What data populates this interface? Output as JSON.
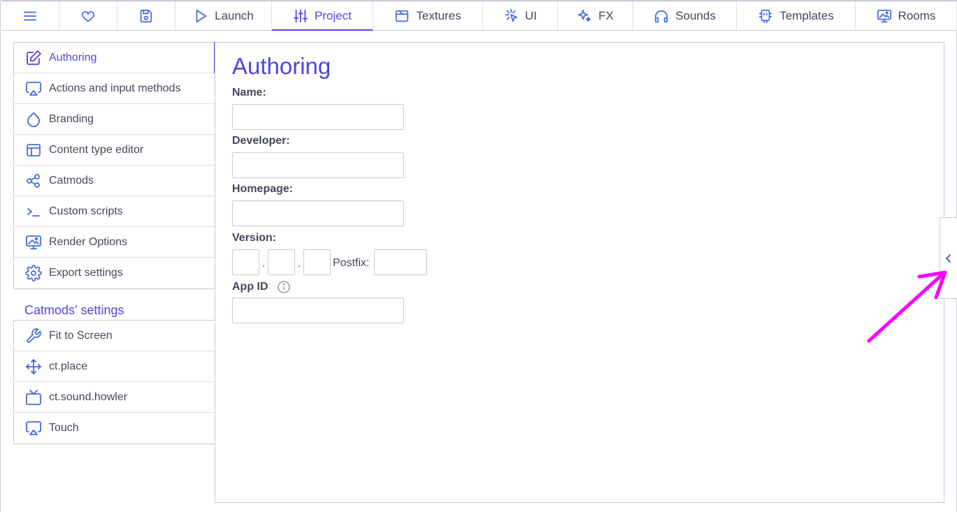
{
  "topbar": {
    "tabs": [
      {
        "label": "",
        "icon": "menu-icon",
        "width": 83
      },
      {
        "label": "",
        "icon": "heart-icon",
        "width": 83
      },
      {
        "label": "",
        "icon": "save-icon",
        "width": 83
      },
      {
        "label": "Launch",
        "icon": "play-icon",
        "width": 138
      },
      {
        "label": "Project",
        "icon": "sliders-icon",
        "width": 145,
        "active": true
      },
      {
        "label": "Textures",
        "icon": "texture-icon",
        "width": 157
      },
      {
        "label": "UI",
        "icon": "ui-cursor-icon",
        "width": 107
      },
      {
        "label": "FX",
        "icon": "sparkles-icon",
        "width": 108
      },
      {
        "label": "Sounds",
        "icon": "headphones-icon",
        "width": 148
      },
      {
        "label": "Templates",
        "icon": "template-icon",
        "width": 170
      },
      {
        "label": "Rooms",
        "icon": "room-icon",
        "width": 145
      }
    ]
  },
  "sidebar": {
    "project_items": [
      {
        "label": "Authoring",
        "icon": "edit-icon",
        "active": true
      },
      {
        "label": "Actions and input methods",
        "icon": "airplay-icon"
      },
      {
        "label": "Branding",
        "icon": "droplet-icon"
      },
      {
        "label": "Content type editor",
        "icon": "layout-icon"
      },
      {
        "label": "Catmods",
        "icon": "modules-icon"
      },
      {
        "label": "Custom scripts",
        "icon": "terminal-icon"
      },
      {
        "label": "Render Options",
        "icon": "monitor-image-icon"
      },
      {
        "label": "Export settings",
        "icon": "gear-icon"
      }
    ],
    "catmods_heading": "Catmods' settings",
    "catmod_items": [
      {
        "label": "Fit to Screen",
        "icon": "wrench-icon"
      },
      {
        "label": "ct.place",
        "icon": "move-icon"
      },
      {
        "label": "ct.sound.howler",
        "icon": "tv-icon"
      },
      {
        "label": "Touch",
        "icon": "airplay-icon"
      }
    ]
  },
  "main": {
    "title": "Authoring",
    "name_label": "Name:",
    "name_value": "",
    "developer_label": "Developer:",
    "developer_value": "",
    "homepage_label": "Homepage:",
    "homepage_value": "",
    "version_label": "Version:",
    "version_separator": ".",
    "postfix_label": "Postfix:",
    "appid_label": "App ID",
    "appid_value": ""
  },
  "colors": {
    "accent": "#5144db",
    "icon": "#446adb",
    "text": "#44475a",
    "border": "#c9cad6",
    "annotation": "#ff00ff"
  }
}
